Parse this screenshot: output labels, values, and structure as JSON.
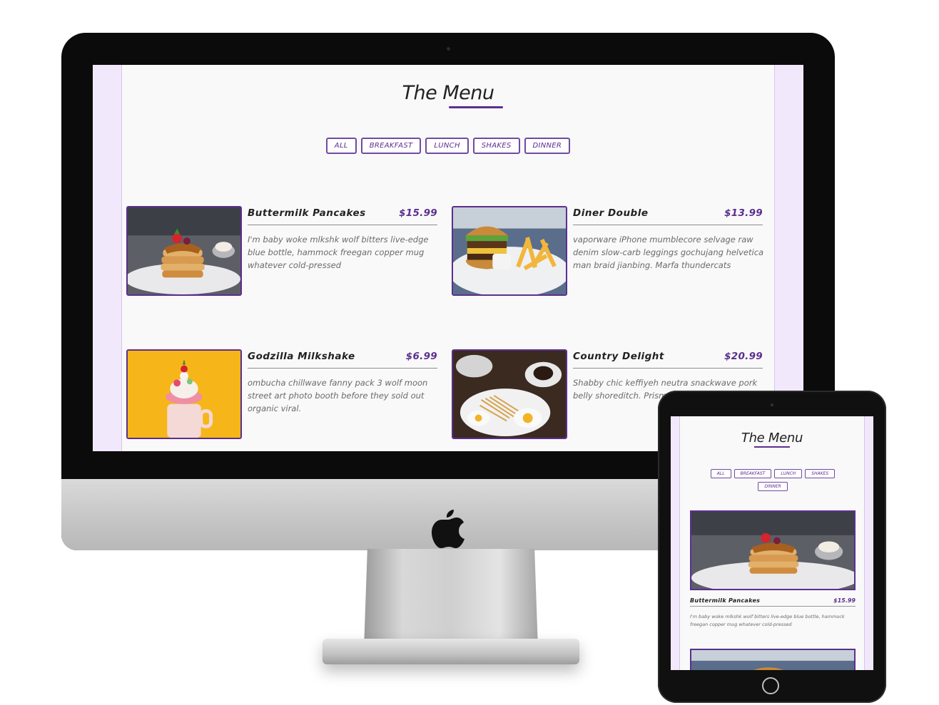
{
  "desktop": {
    "page": {
      "title": "The Menu",
      "filters": [
        "ALL",
        "BREAKFAST",
        "LUNCH",
        "SHAKES",
        "DINNER"
      ],
      "items": [
        {
          "name": "Buttermilk Pancakes",
          "price": "$15.99",
          "description": "I'm baby woke mlkshk wolf bitters live-edge blue bottle, hammock freegan copper mug whatever cold-pressed",
          "image": "pancakes-photo"
        },
        {
          "name": "Diner Double",
          "price": "$13.99",
          "description": "vaporware iPhone mumblecore selvage raw denim slow-carb leggings gochujang helvetica man braid jianbing. Marfa thundercats",
          "image": "burger-fries-photo"
        },
        {
          "name": "Godzilla Milkshake",
          "price": "$6.99",
          "description": "ombucha chillwave fanny pack 3 wolf moon street art photo booth before they sold out organic viral.",
          "image": "milkshake-photo"
        },
        {
          "name": "Country Delight",
          "price": "$20.99",
          "description": "Shabby chic keffiyeh neutra snackwave pork belly shoreditch. Prism austin mlkshk truffaut,",
          "image": "breakfast-plate-photo"
        }
      ]
    }
  },
  "tablet": {
    "page": {
      "title": "The Menu",
      "filters": [
        "ALL",
        "BREAKFAST",
        "LUNCH",
        "SHAKES",
        "DINNER"
      ],
      "items": [
        {
          "name": "Buttermilk Pancakes",
          "price": "$15.99",
          "description": "I'm baby woke mlkshk wolf bitters live-edge blue bottle, hammock freegan copper mug whatever cold-pressed",
          "image": "pancakes-photo"
        }
      ]
    }
  },
  "colors": {
    "accent": "#5b2f8e",
    "page_bg": "#f9f9f9",
    "frame_bg": "#f2e8fb",
    "device_black": "#0b0b0b"
  }
}
